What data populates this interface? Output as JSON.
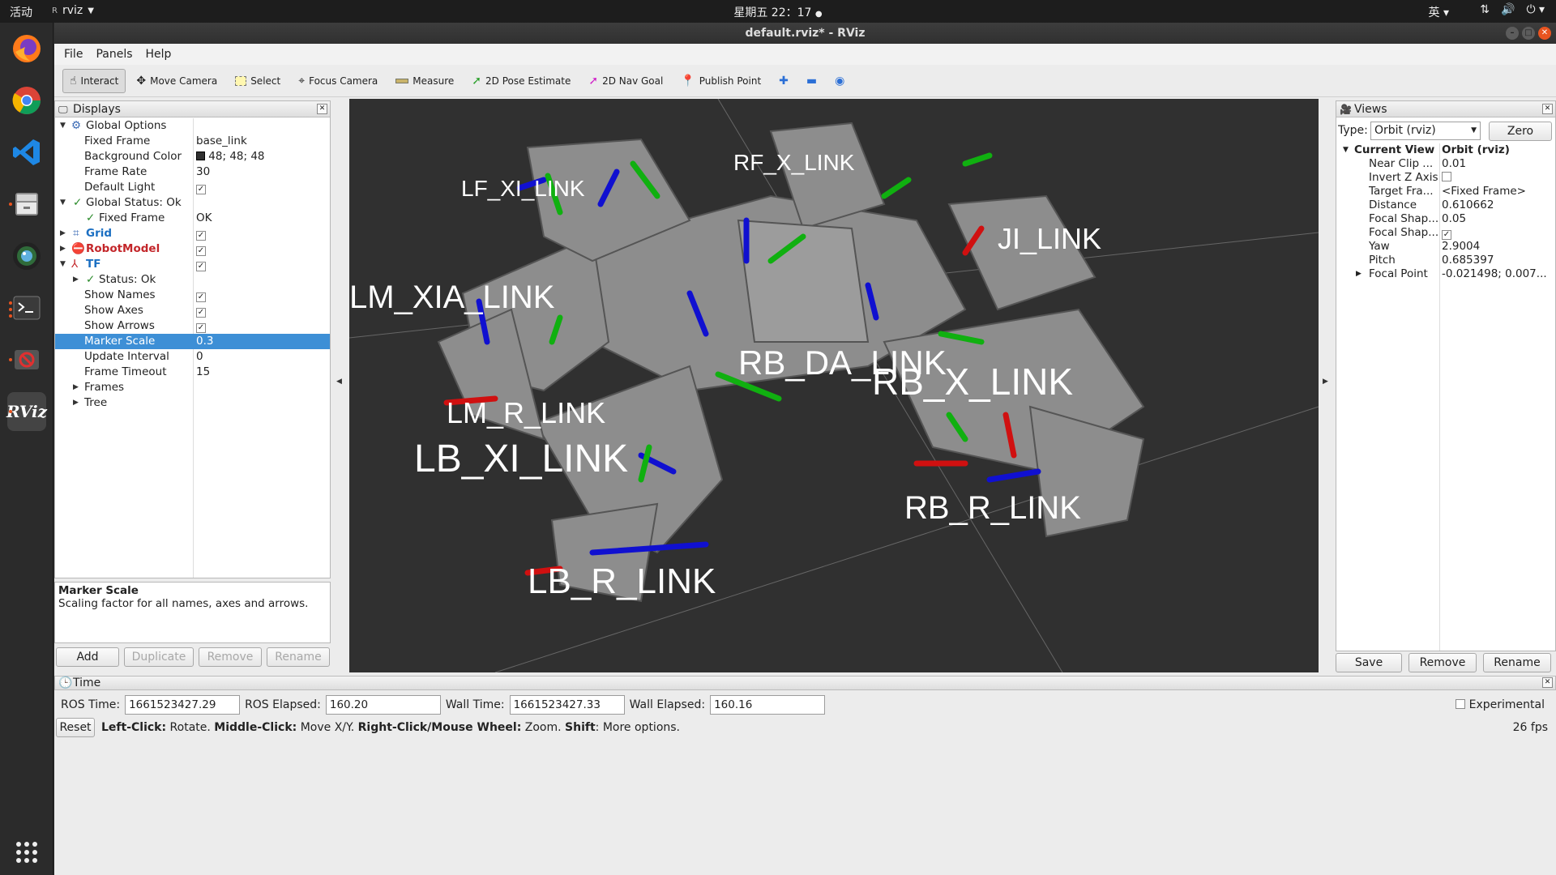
{
  "topbar": {
    "activities": "活动",
    "app_name": "rviz",
    "clock": "星期五 22：17",
    "input_method": "英"
  },
  "window": {
    "title": "default.rviz* - RViz"
  },
  "menu": {
    "file": "File",
    "panels": "Panels",
    "help": "Help"
  },
  "toolbar": {
    "interact": "Interact",
    "move_camera": "Move Camera",
    "select": "Select",
    "focus_camera": "Focus Camera",
    "measure": "Measure",
    "pose_estimate": "2D Pose Estimate",
    "nav_goal": "2D Nav Goal",
    "publish_point": "Publish Point"
  },
  "displays": {
    "title": "Displays",
    "global_options": "Global Options",
    "fixed_frame_label": "Fixed Frame",
    "fixed_frame_value": "base_link",
    "bg_color_label": "Background Color",
    "bg_color_value": "48; 48; 48",
    "bg_color_hex": "#303030",
    "frame_rate_label": "Frame Rate",
    "frame_rate_value": "30",
    "default_light_label": "Default Light",
    "global_status": "Global Status: Ok",
    "status_fixed_frame_label": "Fixed Frame",
    "status_fixed_frame_value": "OK",
    "grid": "Grid",
    "robot_model": "RobotModel",
    "tf": "TF",
    "tf_status": "Status: Ok",
    "show_names": "Show Names",
    "show_axes": "Show Axes",
    "show_arrows": "Show Arrows",
    "marker_scale_label": "Marker Scale",
    "marker_scale_value": "0.3",
    "update_interval_label": "Update Interval",
    "update_interval_value": "0",
    "frame_timeout_label": "Frame Timeout",
    "frame_timeout_value": "15",
    "frames": "Frames",
    "tree": "Tree"
  },
  "help": {
    "title": "Marker Scale",
    "text": "Scaling factor for all names, axes and arrows."
  },
  "display_buttons": {
    "add": "Add",
    "duplicate": "Duplicate",
    "remove": "Remove",
    "rename": "Rename"
  },
  "viewport_labels": [
    "LF_XI_LINK",
    "RF_X_LINK",
    "LM_XIA_LINK",
    "LB_XI_LINK",
    "RB_DA_LINK",
    "RB_X_LINK",
    "RB_R_LINK",
    "LB_R_LINK",
    "LM_R_LINK",
    "JI_LINK"
  ],
  "views": {
    "title": "Views",
    "type_label": "Type:",
    "type_value": "Orbit (rviz)",
    "zero": "Zero",
    "current_view": "Current View",
    "current_view_value": "Orbit (rviz)",
    "near_clip_label": "Near Clip ...",
    "near_clip_value": "0.01",
    "invert_z_label": "Invert Z Axis",
    "target_frame_label": "Target Fra...",
    "target_frame_value": "<Fixed Frame>",
    "distance_label": "Distance",
    "distance_value": "0.610662",
    "focal_shape1_label": "Focal Shap...",
    "focal_shape1_value": "0.05",
    "focal_shape2_label": "Focal Shap...",
    "yaw_label": "Yaw",
    "yaw_value": "2.9004",
    "pitch_label": "Pitch",
    "pitch_value": "0.685397",
    "focal_point_label": "Focal Point",
    "focal_point_value": "-0.021498; 0.007...",
    "save": "Save",
    "remove": "Remove",
    "rename": "Rename"
  },
  "time": {
    "title": "Time",
    "ros_time_label": "ROS Time:",
    "ros_time_value": "1661523427.29",
    "ros_elapsed_label": "ROS Elapsed:",
    "ros_elapsed_value": "160.20",
    "wall_time_label": "Wall Time:",
    "wall_time_value": "1661523427.33",
    "wall_elapsed_label": "Wall Elapsed:",
    "wall_elapsed_value": "160.16",
    "experimental": "Experimental"
  },
  "status": {
    "reset": "Reset",
    "left_click": "Left-Click:",
    "left_click_action": " Rotate. ",
    "middle_click": "Middle-Click:",
    "middle_click_action": " Move X/Y. ",
    "right_click": "Right-Click/Mouse Wheel:",
    "right_click_action": " Zoom. ",
    "shift": "Shift",
    "shift_action": ": More options.",
    "fps": "26 fps"
  }
}
